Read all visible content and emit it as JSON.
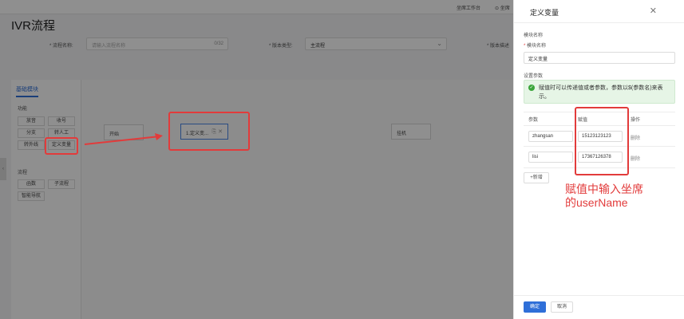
{
  "topbar": {
    "workbench": "坐席工作台",
    "user": "⊙ 坐席"
  },
  "page": {
    "title": "IVR流程"
  },
  "form": {
    "name_label": "* 流程名称:",
    "name_placeholder": "请输入流程名称",
    "name_count": "0/32",
    "version_label": "* 版本类型:",
    "version_value": "主流程",
    "desc_label": "* 版本描述"
  },
  "palette": {
    "tab": "基础模块",
    "function_title": "功能",
    "function_items": [
      "放音",
      "收号",
      "分支",
      "转人工",
      "转外线",
      "定义变量"
    ],
    "flow_title": "流程",
    "flow_items": [
      "函数",
      "子流程",
      "智能导航"
    ]
  },
  "canvas": {
    "start_node": "开始",
    "var_node": "1.定义变...",
    "hangup_node": "挂机"
  },
  "drawer": {
    "title": "定义变量",
    "module_name_section": "模块名称",
    "module_name_label": "模块名称",
    "module_name_value": "定义变量",
    "params_section": "设置参数",
    "alert_text": "赋值时可以传递值或者参数，参数以$(参数名)来表示。",
    "table_headers": [
      "参数",
      "赋值",
      "操作"
    ],
    "rows": [
      {
        "param": "zhangsan",
        "value": "15123123123",
        "action": "删除"
      },
      {
        "param": "lisi",
        "value": "17367126378",
        "action": "删除"
      }
    ],
    "add_label": "+新增",
    "ok_label": "确定",
    "cancel_label": "取消"
  },
  "annotation": {
    "line1": "赋值中输入坐席",
    "line2": "的userName"
  },
  "colors": {
    "primary": "#2f6fd8",
    "annotation": "#e23b3b",
    "success": "#3aa53a"
  }
}
